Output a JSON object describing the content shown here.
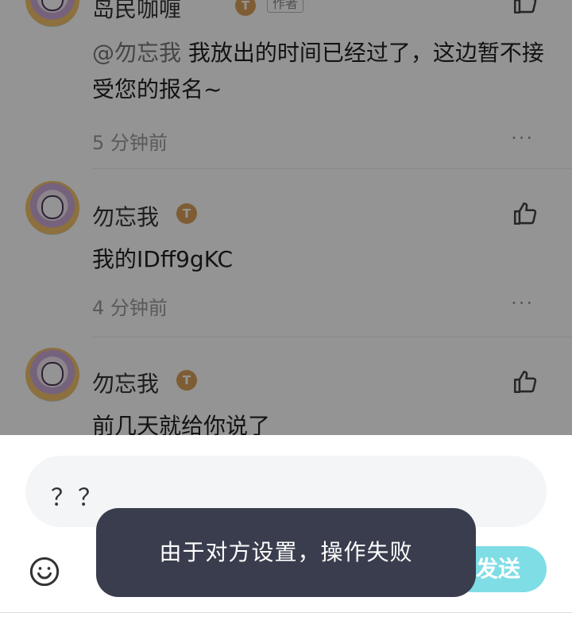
{
  "comments": [
    {
      "name": "岛民咖喱",
      "tag": "作者",
      "badge_letter": "T",
      "mention": "@勿忘我",
      "text": "我放出的时间已经过了，这边暂不接受您的报名~",
      "time": "5 分钟前"
    },
    {
      "name": "勿忘我",
      "badge_letter": "T",
      "text": "我的IDff9gKC",
      "time": "4 分钟前"
    },
    {
      "name": "勿忘我",
      "badge_letter": "T",
      "text": "前几天就给你说了"
    }
  ],
  "more_glyph": "···",
  "input": {
    "value": "？？"
  },
  "send_label": "发送",
  "toast": "由于对方设置，操作失败",
  "colors": {
    "overlay": "rgba(0,0,0,0.42)",
    "send_button": "#7fdde6",
    "toast_bg": "#3a3d4d",
    "input_bg": "#f4f5f7"
  },
  "icons": {
    "like": "thumbs-up-icon",
    "emoji": "smiley-icon",
    "more": "more-dots-icon"
  }
}
